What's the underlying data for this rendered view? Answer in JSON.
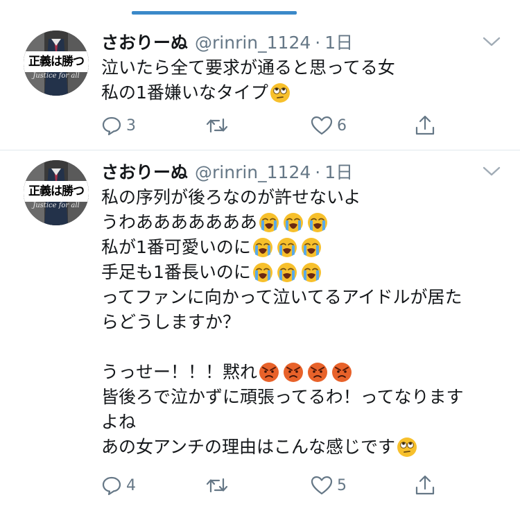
{
  "tweets": [
    {
      "avatar": {
        "banner_text": "正義は勝つ",
        "sub_text": "Justice for all"
      },
      "name": "さおりーぬ",
      "handle": "@rinrin_1124",
      "separator": "·",
      "time": "1日",
      "lines": [
        {
          "text": "泣いたら全て要求が通ると思ってる女",
          "emojis": []
        },
        {
          "text": "私の1番嫌いなタイプ",
          "emojis": [
            "eye-roll"
          ]
        }
      ],
      "actions": {
        "reply_count": "3",
        "retweet_count": "",
        "like_count": "6"
      }
    },
    {
      "avatar": {
        "banner_text": "正義は勝つ",
        "sub_text": "Justice for all"
      },
      "name": "さおりーぬ",
      "handle": "@rinrin_1124",
      "separator": "·",
      "time": "1日",
      "lines": [
        {
          "text": "私の序列が後ろなのが許せないよ",
          "emojis": []
        },
        {
          "text": "うわあああああああ",
          "emojis": [
            "crying",
            "crying",
            "crying"
          ]
        },
        {
          "text": "私が1番可愛いのに",
          "emojis": [
            "crying",
            "crying",
            "crying"
          ]
        },
        {
          "text": "手足も1番長いのに",
          "emojis": [
            "crying",
            "crying",
            "crying"
          ]
        },
        {
          "text": "ってファンに向かって泣いてるアイドルが居た",
          "emojis": []
        },
        {
          "text": "らどうしますか？",
          "emojis": []
        },
        {
          "text": "",
          "emojis": []
        },
        {
          "text": "うっせー！！！黙れ",
          "emojis": [
            "angry",
            "angry",
            "angry",
            "angry"
          ]
        },
        {
          "text": "皆後ろで泣かずに頑張ってるわ！ってなります",
          "emojis": []
        },
        {
          "text": "よね",
          "emojis": []
        },
        {
          "text": "あの女アンチの理由はこんな感じです",
          "emojis": [
            "eye-roll"
          ]
        }
      ],
      "actions": {
        "reply_count": "4",
        "retweet_count": "",
        "like_count": "5"
      }
    }
  ],
  "colors": {
    "accent": "#3b89c9",
    "text": "#14171a",
    "secondary": "#657786",
    "divider": "#e1e8ed",
    "emoji_yellow": "#f7c02c",
    "emoji_angry": "#e8622a",
    "tear_blue": "#5aa9e6"
  },
  "icons": [
    "reply-icon",
    "retweet-icon",
    "like-icon",
    "share-icon",
    "chevron-down-icon"
  ]
}
